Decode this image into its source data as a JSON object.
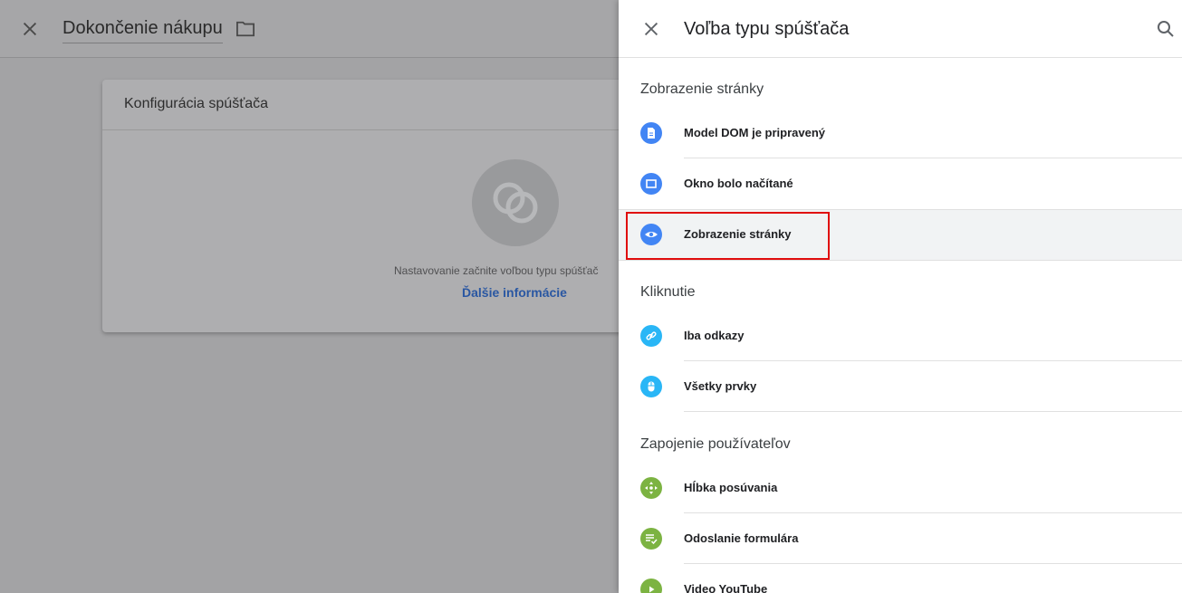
{
  "background": {
    "title": "Dokončenie nákupu",
    "card": {
      "title": "Konfigurácia spúšťača",
      "hint": "Nastavovanie začnite voľbou typu spúšťač",
      "link": "Ďalšie informácie"
    }
  },
  "panel": {
    "title": "Voľba typu spúšťača",
    "sections": [
      {
        "title": "Zobrazenie stránky",
        "items": [
          {
            "label": "Model DOM je pripravený",
            "icon": "document-icon",
            "color": "#4285f4"
          },
          {
            "label": "Okno bolo načítané",
            "icon": "window-icon",
            "color": "#4285f4"
          },
          {
            "label": "Zobrazenie stránky",
            "icon": "eye-icon",
            "color": "#4285f4",
            "selected": true
          }
        ]
      },
      {
        "title": "Kliknutie",
        "items": [
          {
            "label": "Iba odkazy",
            "icon": "link-icon",
            "color": "#29b6f6"
          },
          {
            "label": "Všetky prvky",
            "icon": "mouse-icon",
            "color": "#29b6f6"
          }
        ]
      },
      {
        "title": "Zapojenie používateľov",
        "items": [
          {
            "label": "Hĺbka posúvania",
            "icon": "scroll-arrows-icon",
            "color": "#7cb342"
          },
          {
            "label": "Odoslanie formulára",
            "icon": "form-check-icon",
            "color": "#7cb342"
          },
          {
            "label": "Video YouTube",
            "icon": "play-icon",
            "color": "#7cb342"
          }
        ]
      }
    ]
  }
}
